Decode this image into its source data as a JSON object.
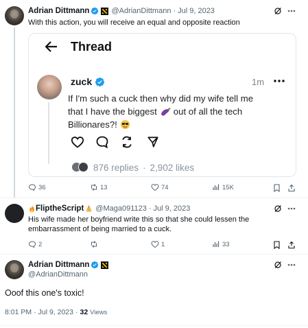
{
  "tweet1": {
    "name": "Adrian Dittmann",
    "handle": "@AdrianDittmann",
    "date": "Jul 9, 2023",
    "text": "With this action, you will receive an equal and opposite reaction",
    "replies": "36",
    "retweets": "13",
    "likes": "74",
    "views": "15K"
  },
  "embedded": {
    "header_title": "Thread",
    "author": "zuck",
    "time": "1m",
    "text_line1": "If I'm such a cuck then why did my wife tell me",
    "text_line2a": "that I have the biggest",
    "text_line2b": "out of all the tech",
    "text_line3": "Billionares?!",
    "replies_count": "876 replies",
    "separator": "·",
    "likes_count": "2,902 likes"
  },
  "tweet2": {
    "name": "FliptheScript",
    "handle": "@Maga091123",
    "date": "Jul 9, 2023",
    "text_line1": "His wife made her boyfriend write this so that she could lessen the",
    "text_line2": "embarrassment of being married to a cuck.",
    "replies": "2",
    "retweets": "",
    "likes": "1",
    "views": "33"
  },
  "tweet3": {
    "name": "Adrian Dittmann",
    "handle": "@AdrianDittmann",
    "text": "Ooof this one's toxic!",
    "time": "8:01 PM",
    "date": "Jul 9, 2023",
    "views_count": "32",
    "views_label": "Views"
  },
  "sep": "·",
  "colors": {
    "verified": "#1d9bf0",
    "text": "#0f1419",
    "muted": "#536471"
  }
}
